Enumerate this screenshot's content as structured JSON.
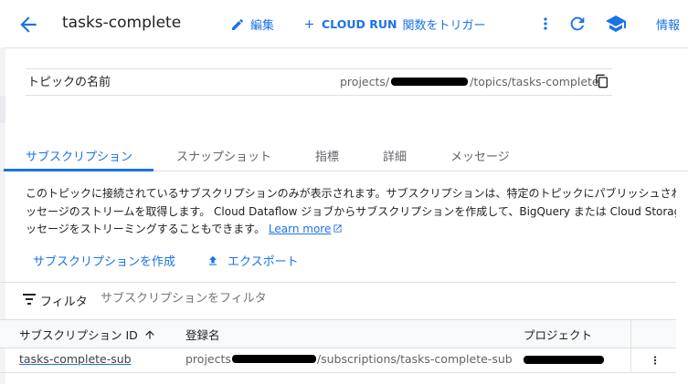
{
  "header": {
    "title": "tasks-complete",
    "edit_label": "編集",
    "trigger_label_en": "CLOUD RUN",
    "trigger_label_jp": "関数をトリガー",
    "info_label": "情報"
  },
  "topic": {
    "label": "トピックの名前",
    "path_prefix": "projects/",
    "path_suffix": "/topics/tasks-complete"
  },
  "tabs": [
    {
      "label": "サブスクリプション",
      "active": true
    },
    {
      "label": "スナップショット",
      "active": false
    },
    {
      "label": "指標",
      "active": false
    },
    {
      "label": "詳細",
      "active": false
    },
    {
      "label": "メッセージ",
      "active": false
    }
  ],
  "description": {
    "line1": "このトピックに接続されているサブスクリプションのみが表示されます。サブスクリプションは、特定のトピックにパブリッシュされたメ",
    "line2": "ッセージのストリームを取得します。 Cloud Dataflow ジョブからサブスクリプションを作成して、BigQuery または Cloud Storage へメ",
    "line3": "ッセージをストリーミングすることもできます。",
    "learn_more": "Learn more"
  },
  "actions": {
    "create_label": "サブスクリプションを作成",
    "export_label": "エクスポート"
  },
  "filter": {
    "label": "フィルタ",
    "placeholder": "サブスクリプションをフィルタ"
  },
  "table": {
    "headers": [
      "サブスクリプション ID",
      "登録名",
      "プロジェクト"
    ],
    "rows": [
      {
        "id": "tasks-complete-sub",
        "name_prefix": "projects",
        "name_suffix": "/subscriptions/tasks-complete-sub"
      }
    ]
  },
  "colors": {
    "accent": "#1a73e8",
    "text": "#202124",
    "muted": "#5f6368",
    "border": "#e0e0e0",
    "redaction": "#000000"
  },
  "icons": [
    "back-arrow-icon",
    "pencil-icon",
    "plus-icon",
    "more-vert-icon",
    "refresh-icon",
    "school-icon",
    "copy-icon",
    "external-link-icon",
    "upload-icon",
    "filter-icon",
    "sort-arrow-up-icon"
  ]
}
